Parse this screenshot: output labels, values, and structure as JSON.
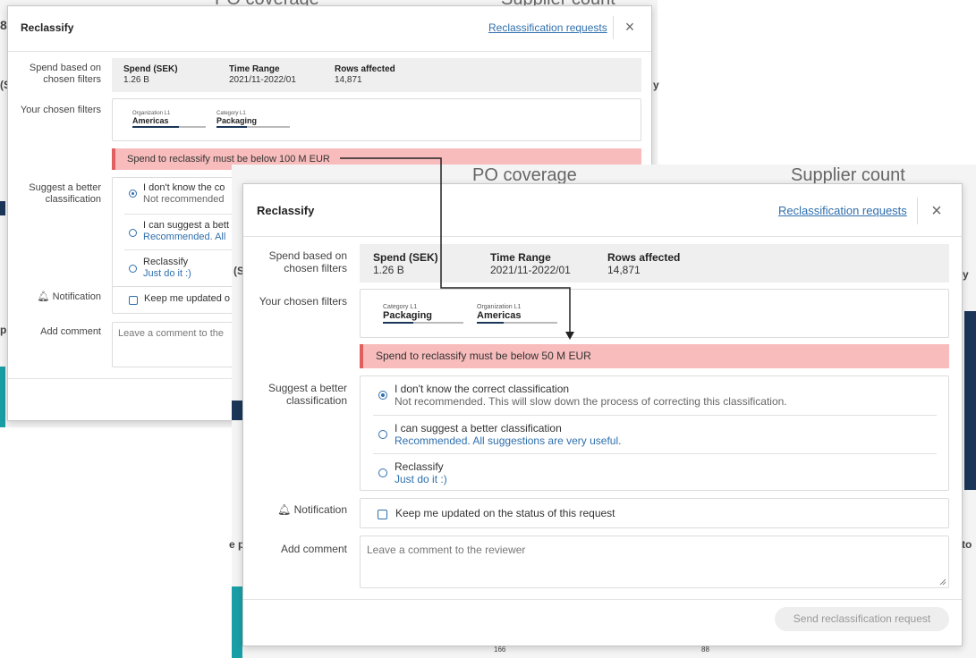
{
  "background": {
    "left": {
      "po_coverage": "PO coverage",
      "supplier_count": "Supplier count",
      "frag_a": "8,",
      "frag_b": "(S",
      "frag_c": "y",
      "frag_d": "p"
    },
    "right": {
      "po_coverage": "PO coverage",
      "supplier_count": "Supplier count",
      "frag_a": "(S",
      "frag_b": "y",
      "frag_c": "e p",
      "frag_d": "to",
      "tick_1": "166",
      "tick_2": "88"
    }
  },
  "dialog_back": {
    "title": "Reclassify",
    "link": "Reclassification requests",
    "close_icon": "×",
    "spend_label": "Spend based on chosen filters",
    "summary": [
      {
        "label": "Spend (SEK)",
        "value": "1.26 B"
      },
      {
        "label": "Time Range",
        "value": "2021/11-2022/01"
      },
      {
        "label": "Rows affected",
        "value": "14,871"
      }
    ],
    "filters_label": "Your chosen filters",
    "filters": [
      {
        "label": "Organization L1",
        "value": "Americas"
      },
      {
        "label": "Category L1",
        "value": "Packaging"
      }
    ],
    "warning": "Spend to reclassify must be below 100 M EUR",
    "suggest_label": "Suggest a better classification",
    "options": [
      {
        "title": "I don't know the co",
        "subtitle": "Not recommended"
      },
      {
        "title": "I can suggest a bett",
        "subtitle": "Recommended. All"
      },
      {
        "title": "Reclassify",
        "subtitle": "Just do it :)"
      }
    ],
    "notification_label": "Notification",
    "notification_icon": "bell-icon",
    "notification_text": "Keep me updated o",
    "comment_label": "Add comment",
    "comment_placeholder": "Leave a comment to the"
  },
  "dialog_front": {
    "title": "Reclassify",
    "link": "Reclassification requests",
    "close_icon": "×",
    "spend_label": "Spend based on chosen filters",
    "summary": [
      {
        "label": "Spend (SEK)",
        "value": "1.26 B"
      },
      {
        "label": "Time Range",
        "value": "2021/11-2022/01"
      },
      {
        "label": "Rows affected",
        "value": "14,871"
      }
    ],
    "filters_label": "Your chosen filters",
    "filters": [
      {
        "label": "Category L1",
        "value": "Packaging"
      },
      {
        "label": "Organization L1",
        "value": "Americas"
      }
    ],
    "warning": "Spend to reclassify must be below 50 M EUR",
    "suggest_label": "Suggest a better classification",
    "options": [
      {
        "title": "I don't know the correct classification",
        "subtitle": "Not recommended. This will slow down the process of correcting this classification."
      },
      {
        "title": "I can suggest a better classification",
        "subtitle": "Recommended. All suggestions are very useful."
      },
      {
        "title": "Reclassify",
        "subtitle": "Just do it :)"
      }
    ],
    "notification_label": "Notification",
    "notification_icon": "bell-icon",
    "notification_text": "Keep me updated on the status of this request",
    "comment_label": "Add comment",
    "comment_placeholder": "Leave a comment to the reviewer",
    "send_button": "Send reclassification request"
  }
}
